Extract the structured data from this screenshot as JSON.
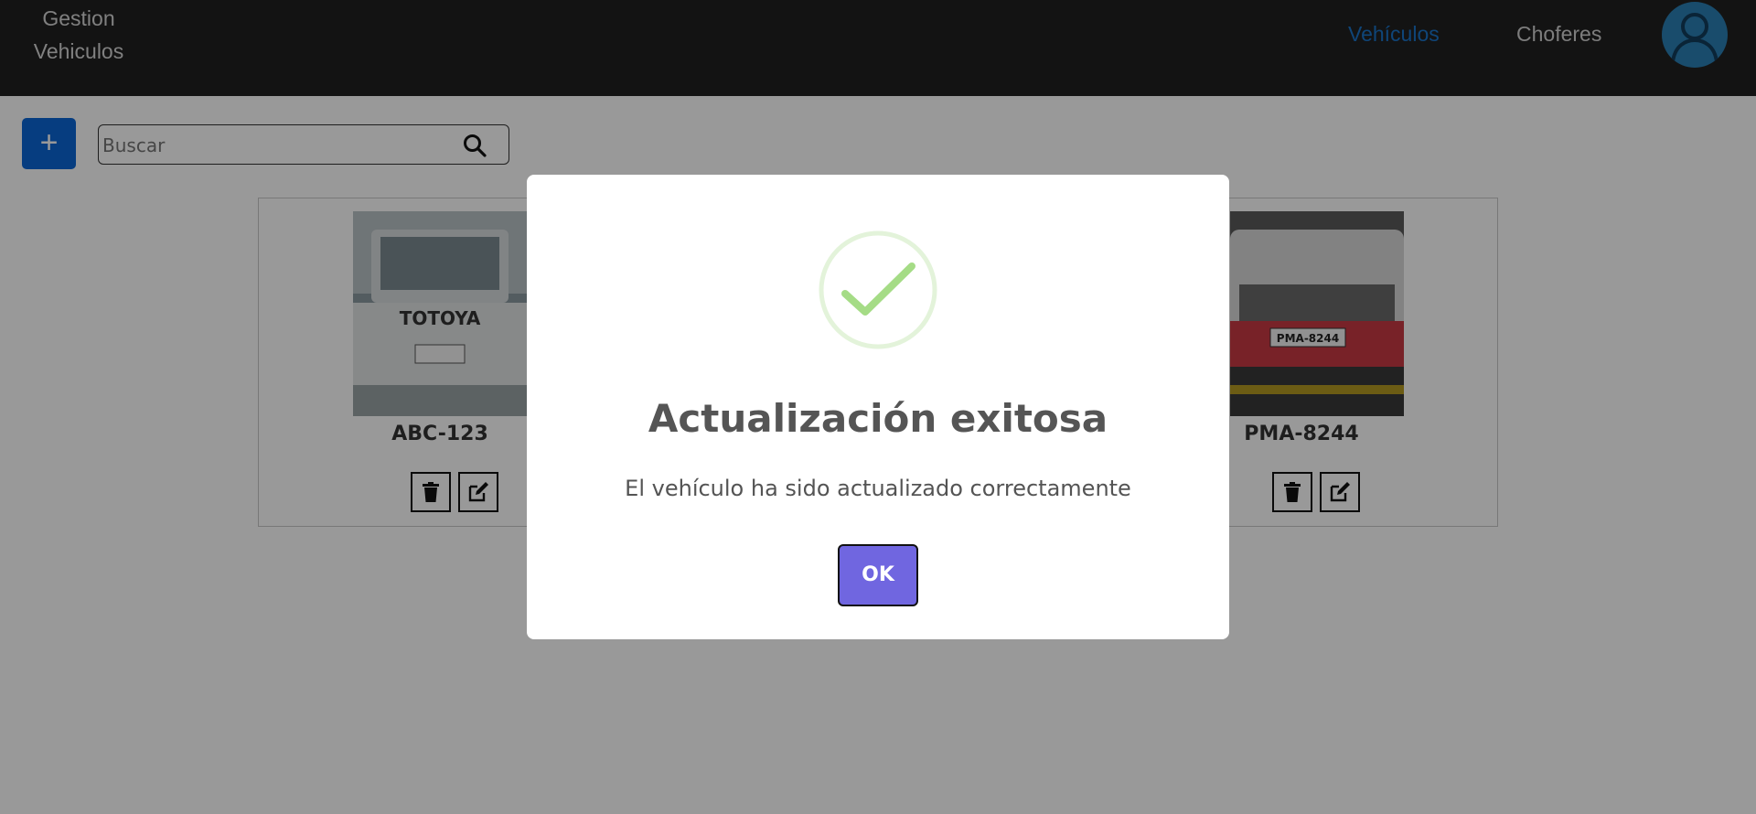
{
  "navbar": {
    "brand_line1": "Gestion",
    "brand_line2": "Vehiculos",
    "links": [
      {
        "label": "Vehículos",
        "active": true
      },
      {
        "label": "Choferes",
        "active": false
      }
    ],
    "avatar_icon": "user-avatar-icon"
  },
  "toolbar": {
    "add_label": "+",
    "search_placeholder": "Buscar",
    "search_icon": "search-icon"
  },
  "vehicles": [
    {
      "plate": "ABC-123",
      "image_text": "TOTOYA"
    },
    {
      "plate": "PMA-8244",
      "image_text": "PMA-8244"
    }
  ],
  "modal": {
    "title": "Actualización exitosa",
    "message": "El vehículo ha sido actualizado correctamente",
    "ok_label": "OK",
    "icon": "success-check-icon"
  },
  "colors": {
    "navbar": "#212121",
    "active_link": "#1a73c9",
    "primary": "#0a66d6",
    "ok_button": "#7066e0",
    "success": "#a5dc86"
  }
}
